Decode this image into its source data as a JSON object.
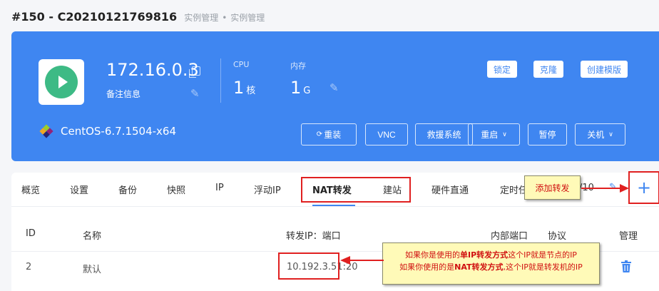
{
  "header": {
    "title": "#150 - C20210121769816",
    "breadcrumbs": [
      "实例管理",
      "实例管理"
    ]
  },
  "instance": {
    "ip": "172.16.0.3",
    "note_label": "备注信息",
    "cpu": {
      "label": "CPU",
      "value": "1",
      "unit": "核"
    },
    "memory": {
      "label": "内存",
      "value": "1",
      "unit": "G"
    },
    "os": "CentOS-6.7.1504-x64",
    "top_buttons": {
      "lock": "锁定",
      "clone": "克隆",
      "create_template": "创建模版"
    },
    "action_buttons": {
      "reinstall": "重装",
      "vnc": "VNC",
      "rescue": "救援系统",
      "reboot": "重启",
      "pause": "暂停",
      "shutdown": "关机"
    }
  },
  "tabs": [
    {
      "label": "概览"
    },
    {
      "label": "设置"
    },
    {
      "label": "备份"
    },
    {
      "label": "快照"
    },
    {
      "label": "IP"
    },
    {
      "label": "浮动IP"
    },
    {
      "label": "NAT转发",
      "active": true
    },
    {
      "label": "建站"
    },
    {
      "label": "硬件直通"
    },
    {
      "label": "定时任"
    }
  ],
  "tab_more_label": "/10",
  "table": {
    "headers": [
      "ID",
      "名称",
      "转发IP：端口",
      "内部端口",
      "协议",
      "管理"
    ],
    "rows": [
      {
        "id": "2",
        "name": "默认",
        "forward": "10.192.3.51:20",
        "internal_port": "",
        "protocol": ""
      }
    ]
  },
  "annotations": {
    "add_forward": "添加转发",
    "ip_note_line1": [
      "如果你是使用的",
      "单IP转发方式",
      "这个IP就是节点的IP"
    ],
    "ip_note_line2": [
      "如果你使用的是",
      "NAT转发方式",
      ",这个IP就是转发机的IP"
    ]
  },
  "colors": {
    "accent": "#3f86f1",
    "play_green": "#3dba85",
    "annotation_red": "#e02020",
    "note_yellow": "#fffab8"
  },
  "icons": [
    "play-icon",
    "copy-icon",
    "edit-icon",
    "centos-logo-icon",
    "refresh-icon",
    "chevron-down-icon",
    "plus-icon",
    "trash-icon",
    "pencil-icon"
  ]
}
